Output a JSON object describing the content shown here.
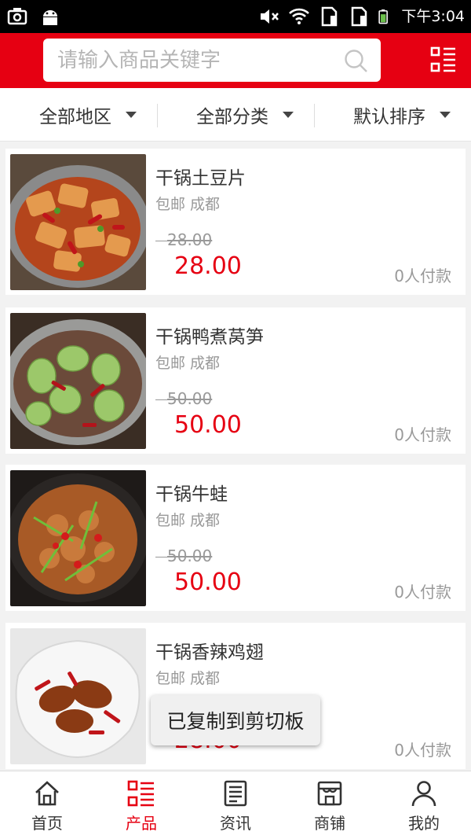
{
  "status_bar": {
    "time": "下午3:04",
    "icons": [
      "screenshot-icon",
      "android-icon",
      "mute-icon",
      "wifi-icon",
      "sim1-icon",
      "sim2-icon",
      "battery-icon"
    ]
  },
  "header": {
    "search_placeholder": "请输入商品关键字",
    "search_icon": "search-icon",
    "menu_icon": "grid-menu-icon",
    "brand_color": "#e60012"
  },
  "filters": [
    {
      "label": "全部地区"
    },
    {
      "label": "全部分类"
    },
    {
      "label": "默认排序"
    }
  ],
  "products": [
    {
      "name": "干锅土豆片",
      "tag": "包邮 成都",
      "old_price": "28.00",
      "price": "28.00",
      "paid": "0人付款"
    },
    {
      "name": "干锅鸭煮莴笋",
      "tag": "包邮 成都",
      "old_price": "50.00",
      "price": "50.00",
      "paid": "0人付款"
    },
    {
      "name": "干锅牛蛙",
      "tag": "包邮 成都",
      "old_price": "50.00",
      "price": "50.00",
      "paid": "0人付款"
    },
    {
      "name": "干锅香辣鸡翅",
      "tag": "包邮 成都",
      "old_price": "",
      "price": "28.00",
      "paid": "0人付款"
    }
  ],
  "toast": "已复制到剪切板",
  "tabs": [
    {
      "label": "首页",
      "icon": "home-icon",
      "active": false
    },
    {
      "label": "产品",
      "icon": "product-list-icon",
      "active": true
    },
    {
      "label": "资讯",
      "icon": "news-icon",
      "active": false
    },
    {
      "label": "商铺",
      "icon": "shop-icon",
      "active": false
    },
    {
      "label": "我的",
      "icon": "user-icon",
      "active": false
    }
  ],
  "colors": {
    "accent": "#e60012",
    "muted": "#999999",
    "background": "#f2f2f2"
  }
}
